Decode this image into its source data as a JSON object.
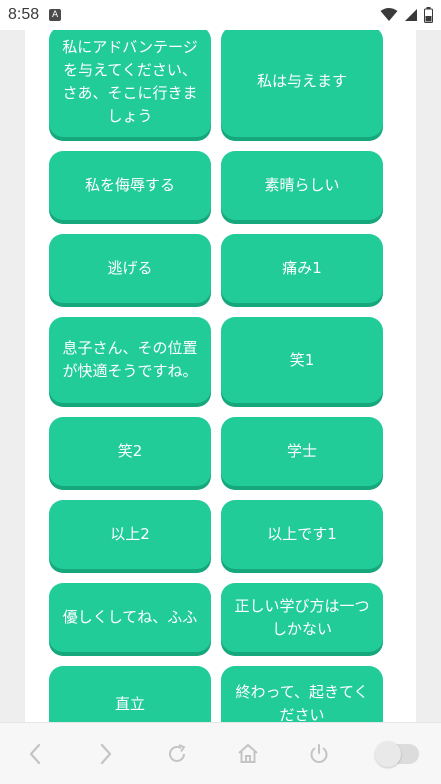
{
  "status_bar": {
    "time": "8:58",
    "notification_icon": "a-icon",
    "icons": [
      "wifi-icon",
      "signal-icon",
      "battery-icon"
    ]
  },
  "buttons": [
    {
      "label": "私にアドバンテージを与えてください、さあ、そこに行きましょう"
    },
    {
      "label": "私は与えます"
    },
    {
      "label": "私を侮辱する"
    },
    {
      "label": "素晴らしい"
    },
    {
      "label": "逃げる"
    },
    {
      "label": "痛み1"
    },
    {
      "label": "息子さん、その位置が快適そうですね。"
    },
    {
      "label": "笑1"
    },
    {
      "label": "笑2"
    },
    {
      "label": "学士"
    },
    {
      "label": "以上2"
    },
    {
      "label": "以上です1"
    },
    {
      "label": "優しくしてね、ふふ"
    },
    {
      "label": "正しい学び方は一つしかない"
    },
    {
      "label": "直立"
    },
    {
      "label": "終わって、起きてください"
    }
  ],
  "colors": {
    "button": "#22cc99",
    "button_shadow": "#16a77c"
  },
  "nav": {
    "items": [
      "back-icon",
      "forward-icon",
      "refresh-icon",
      "home-icon",
      "power-icon",
      "toggle-switch"
    ]
  }
}
